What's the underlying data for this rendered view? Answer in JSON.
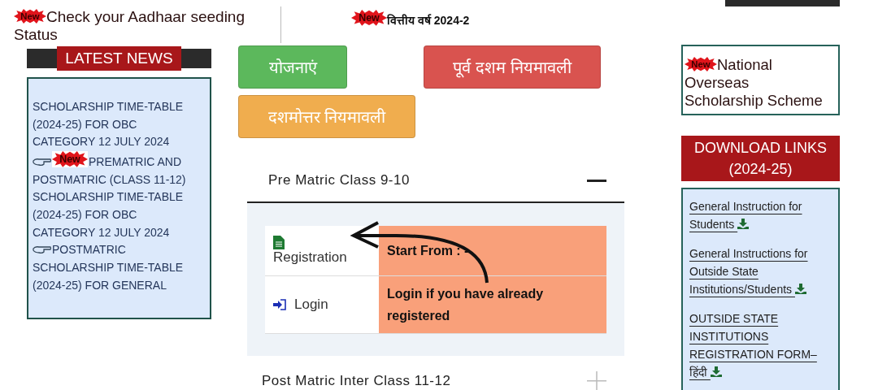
{
  "top_notice": {
    "badge": "New",
    "text": "Check your Aadhaar seeding Status"
  },
  "ticker": {
    "badge": "New",
    "text": "वित्तीय वर्ष 2024-2"
  },
  "latest_news": {
    "title": "LATEST NEWS",
    "items": [
      {
        "pointer": false,
        "text": "SCHOLARSHIP TIME-TABLE (2024-25) FOR OBC CATEGORY 12 JULY 2024"
      },
      {
        "pointer": true,
        "badge": "New",
        "text": "PREMATRIC AND POSTMATRIC (CLASS 11-12) SCHOLARSHIP TIME-TABLE (2024-25) FOR OBC CATEGORY 12 JULY 2024"
      },
      {
        "pointer": true,
        "text": "POSTMATRIC SCHOLARSHIP TIME-TABLE (2024-25) FOR GENERAL"
      }
    ]
  },
  "nav_buttons": [
    {
      "label": "योजनाएं",
      "kind": "success"
    },
    {
      "label": "पूर्व दशम नियमावली",
      "kind": "danger"
    },
    {
      "label": "दशमोत्तर नियमावली",
      "kind": "warning"
    }
  ],
  "accordion": [
    {
      "title": "Pre Matric Class 9-10",
      "expanded": true,
      "rows": [
        {
          "kind": "document",
          "label": "Registration",
          "info": "Start From : -"
        },
        {
          "kind": "login",
          "label": "Login",
          "info": "Login if you have already registered"
        }
      ]
    },
    {
      "title": "Post Matric Inter Class 11-12",
      "expanded": false
    }
  ],
  "scheme_notice": {
    "badge": "New",
    "text": "National Overseas Scholarship Scheme"
  },
  "downloads": {
    "title": "DOWNLOAD LINKS (2024-25)",
    "links": [
      {
        "text": "General Instruction for Students"
      },
      {
        "text": "General Instructions for Outside State Institutions/Students"
      },
      {
        "text": "OUTSIDE STATE INSTITUTIONS REGISTRATION FORM–हिंदी"
      }
    ]
  }
}
